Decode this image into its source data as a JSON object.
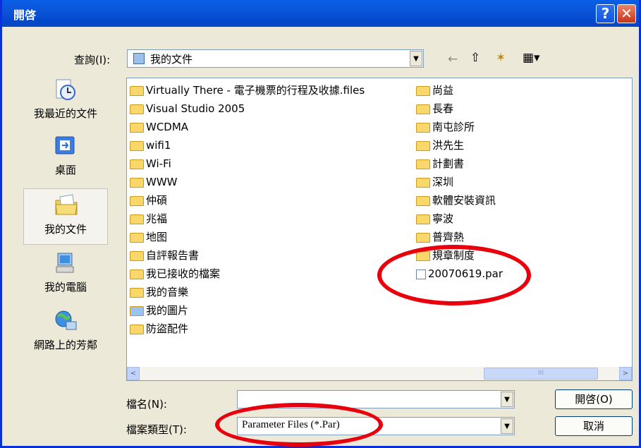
{
  "window": {
    "title": "開啓",
    "help": "?",
    "close": "✕"
  },
  "lookin": {
    "label": "查詢(I):",
    "value": "我的文件"
  },
  "places": [
    {
      "name": "recent",
      "label": "我最近的文件"
    },
    {
      "name": "desktop",
      "label": "桌面"
    },
    {
      "name": "mydocs",
      "label": "我的文件"
    },
    {
      "name": "mycomputer",
      "label": "我的電腦"
    },
    {
      "name": "network",
      "label": "網路上的芳鄰"
    }
  ],
  "files_left": [
    "Virtually There - 電子機票的行程及收據.files",
    "Visual Studio 2005",
    "WCDMA",
    "wifi1",
    "Wi-Fi",
    "WWW",
    "仲碩",
    "兆福",
    "地图",
    "自評報告書",
    "我已接收的檔案",
    "我的音樂",
    "我的圖片",
    "防盜配件"
  ],
  "files_right": [
    "尚益",
    "長春",
    "南屯診所",
    "洪先生",
    "計劃書",
    "深圳",
    "軟體安裝資訊",
    "寧波",
    "普齊熱",
    "規章制度",
    "20070619.par"
  ],
  "filename": {
    "label": "檔名(N):",
    "value": ""
  },
  "filetype": {
    "label": "檔案類型(T):",
    "value": "Parameter Files (*.Par)"
  },
  "buttons": {
    "open": "開啓(O)",
    "cancel": "取消"
  },
  "scroll": {
    "left": "<",
    "right": ">",
    "grip": "III"
  },
  "toolbar": {
    "back": "←",
    "up": "⇧",
    "newfolder": "✶",
    "views": "▦▾"
  },
  "colors": {
    "title_bar": "#0a5fe7",
    "annotation": "#e8000c"
  }
}
